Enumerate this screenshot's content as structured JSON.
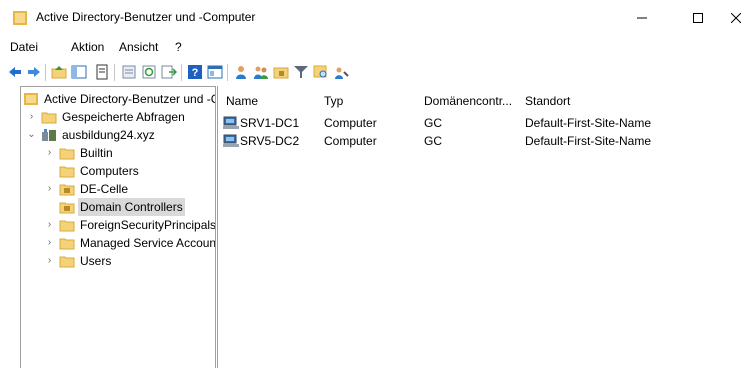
{
  "window": {
    "title": "Active Directory-Benutzer und -Computer"
  },
  "menu": [
    "Datei",
    "Aktion",
    "Ansicht",
    "?"
  ],
  "tree": {
    "root": "Active Directory-Benutzer und -C",
    "saved_queries": "Gespeicherte Abfragen",
    "domain": "ausbildung24.xyz",
    "children": [
      "Builtin",
      "Computers",
      "DE-Celle",
      "Domain Controllers",
      "ForeignSecurityPrincipals",
      "Managed Service Accoun",
      "Users"
    ],
    "selected": "Domain Controllers"
  },
  "list": {
    "columns": [
      "Name",
      "Typ",
      "Domänencontr...",
      "Standort"
    ],
    "rows": [
      {
        "name": "SRV1-DC1",
        "type": "Computer",
        "dc_type": "GC",
        "site": "Default-First-Site-Name"
      },
      {
        "name": "SRV5-DC2",
        "type": "Computer",
        "dc_type": "GC",
        "site": "Default-First-Site-Name"
      }
    ]
  },
  "colors": {
    "folder": "#f3d27a",
    "folder_dark": "#d8a93a",
    "back_arrow": "#1e6fd0",
    "selection": "#d9d9d9",
    "border": "#a0a0a0"
  },
  "icons": [
    "back-arrow-icon",
    "forward-arrow-icon",
    "up-folder-icon",
    "show-hide-tree-icon",
    "properties-icon",
    "refresh-icon",
    "export-list-icon",
    "help-icon",
    "console-view-icon",
    "new-user-icon",
    "new-group-icon",
    "new-ou-icon",
    "filter-icon",
    "find-icon",
    "add-to-group-icon"
  ]
}
